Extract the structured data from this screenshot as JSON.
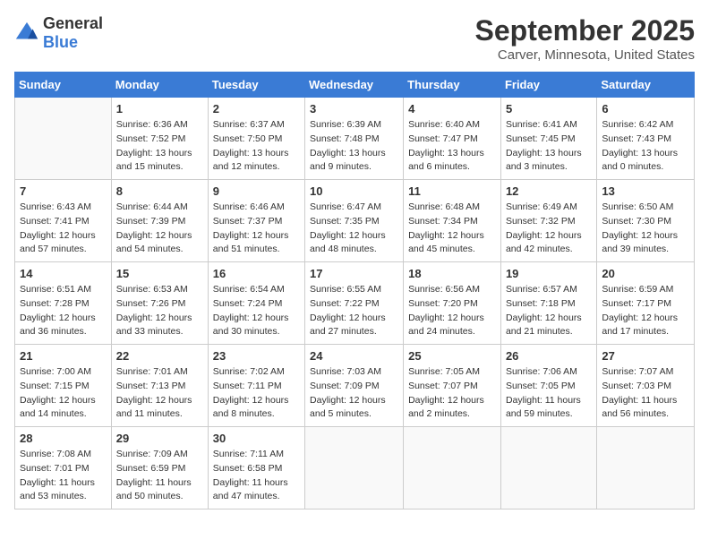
{
  "header": {
    "logo": {
      "general": "General",
      "blue": "Blue"
    },
    "title": "September 2025",
    "subtitle": "Carver, Minnesota, United States"
  },
  "calendar": {
    "weekdays": [
      "Sunday",
      "Monday",
      "Tuesday",
      "Wednesday",
      "Thursday",
      "Friday",
      "Saturday"
    ],
    "weeks": [
      [
        {
          "day": "",
          "sunrise": "",
          "sunset": "",
          "daylight": ""
        },
        {
          "day": "1",
          "sunrise": "Sunrise: 6:36 AM",
          "sunset": "Sunset: 7:52 PM",
          "daylight": "Daylight: 13 hours and 15 minutes."
        },
        {
          "day": "2",
          "sunrise": "Sunrise: 6:37 AM",
          "sunset": "Sunset: 7:50 PM",
          "daylight": "Daylight: 13 hours and 12 minutes."
        },
        {
          "day": "3",
          "sunrise": "Sunrise: 6:39 AM",
          "sunset": "Sunset: 7:48 PM",
          "daylight": "Daylight: 13 hours and 9 minutes."
        },
        {
          "day": "4",
          "sunrise": "Sunrise: 6:40 AM",
          "sunset": "Sunset: 7:47 PM",
          "daylight": "Daylight: 13 hours and 6 minutes."
        },
        {
          "day": "5",
          "sunrise": "Sunrise: 6:41 AM",
          "sunset": "Sunset: 7:45 PM",
          "daylight": "Daylight: 13 hours and 3 minutes."
        },
        {
          "day": "6",
          "sunrise": "Sunrise: 6:42 AM",
          "sunset": "Sunset: 7:43 PM",
          "daylight": "Daylight: 13 hours and 0 minutes."
        }
      ],
      [
        {
          "day": "7",
          "sunrise": "Sunrise: 6:43 AM",
          "sunset": "Sunset: 7:41 PM",
          "daylight": "Daylight: 12 hours and 57 minutes."
        },
        {
          "day": "8",
          "sunrise": "Sunrise: 6:44 AM",
          "sunset": "Sunset: 7:39 PM",
          "daylight": "Daylight: 12 hours and 54 minutes."
        },
        {
          "day": "9",
          "sunrise": "Sunrise: 6:46 AM",
          "sunset": "Sunset: 7:37 PM",
          "daylight": "Daylight: 12 hours and 51 minutes."
        },
        {
          "day": "10",
          "sunrise": "Sunrise: 6:47 AM",
          "sunset": "Sunset: 7:35 PM",
          "daylight": "Daylight: 12 hours and 48 minutes."
        },
        {
          "day": "11",
          "sunrise": "Sunrise: 6:48 AM",
          "sunset": "Sunset: 7:34 PM",
          "daylight": "Daylight: 12 hours and 45 minutes."
        },
        {
          "day": "12",
          "sunrise": "Sunrise: 6:49 AM",
          "sunset": "Sunset: 7:32 PM",
          "daylight": "Daylight: 12 hours and 42 minutes."
        },
        {
          "day": "13",
          "sunrise": "Sunrise: 6:50 AM",
          "sunset": "Sunset: 7:30 PM",
          "daylight": "Daylight: 12 hours and 39 minutes."
        }
      ],
      [
        {
          "day": "14",
          "sunrise": "Sunrise: 6:51 AM",
          "sunset": "Sunset: 7:28 PM",
          "daylight": "Daylight: 12 hours and 36 minutes."
        },
        {
          "day": "15",
          "sunrise": "Sunrise: 6:53 AM",
          "sunset": "Sunset: 7:26 PM",
          "daylight": "Daylight: 12 hours and 33 minutes."
        },
        {
          "day": "16",
          "sunrise": "Sunrise: 6:54 AM",
          "sunset": "Sunset: 7:24 PM",
          "daylight": "Daylight: 12 hours and 30 minutes."
        },
        {
          "day": "17",
          "sunrise": "Sunrise: 6:55 AM",
          "sunset": "Sunset: 7:22 PM",
          "daylight": "Daylight: 12 hours and 27 minutes."
        },
        {
          "day": "18",
          "sunrise": "Sunrise: 6:56 AM",
          "sunset": "Sunset: 7:20 PM",
          "daylight": "Daylight: 12 hours and 24 minutes."
        },
        {
          "day": "19",
          "sunrise": "Sunrise: 6:57 AM",
          "sunset": "Sunset: 7:18 PM",
          "daylight": "Daylight: 12 hours and 21 minutes."
        },
        {
          "day": "20",
          "sunrise": "Sunrise: 6:59 AM",
          "sunset": "Sunset: 7:17 PM",
          "daylight": "Daylight: 12 hours and 17 minutes."
        }
      ],
      [
        {
          "day": "21",
          "sunrise": "Sunrise: 7:00 AM",
          "sunset": "Sunset: 7:15 PM",
          "daylight": "Daylight: 12 hours and 14 minutes."
        },
        {
          "day": "22",
          "sunrise": "Sunrise: 7:01 AM",
          "sunset": "Sunset: 7:13 PM",
          "daylight": "Daylight: 12 hours and 11 minutes."
        },
        {
          "day": "23",
          "sunrise": "Sunrise: 7:02 AM",
          "sunset": "Sunset: 7:11 PM",
          "daylight": "Daylight: 12 hours and 8 minutes."
        },
        {
          "day": "24",
          "sunrise": "Sunrise: 7:03 AM",
          "sunset": "Sunset: 7:09 PM",
          "daylight": "Daylight: 12 hours and 5 minutes."
        },
        {
          "day": "25",
          "sunrise": "Sunrise: 7:05 AM",
          "sunset": "Sunset: 7:07 PM",
          "daylight": "Daylight: 12 hours and 2 minutes."
        },
        {
          "day": "26",
          "sunrise": "Sunrise: 7:06 AM",
          "sunset": "Sunset: 7:05 PM",
          "daylight": "Daylight: 11 hours and 59 minutes."
        },
        {
          "day": "27",
          "sunrise": "Sunrise: 7:07 AM",
          "sunset": "Sunset: 7:03 PM",
          "daylight": "Daylight: 11 hours and 56 minutes."
        }
      ],
      [
        {
          "day": "28",
          "sunrise": "Sunrise: 7:08 AM",
          "sunset": "Sunset: 7:01 PM",
          "daylight": "Daylight: 11 hours and 53 minutes."
        },
        {
          "day": "29",
          "sunrise": "Sunrise: 7:09 AM",
          "sunset": "Sunset: 6:59 PM",
          "daylight": "Daylight: 11 hours and 50 minutes."
        },
        {
          "day": "30",
          "sunrise": "Sunrise: 7:11 AM",
          "sunset": "Sunset: 6:58 PM",
          "daylight": "Daylight: 11 hours and 47 minutes."
        },
        {
          "day": "",
          "sunrise": "",
          "sunset": "",
          "daylight": ""
        },
        {
          "day": "",
          "sunrise": "",
          "sunset": "",
          "daylight": ""
        },
        {
          "day": "",
          "sunrise": "",
          "sunset": "",
          "daylight": ""
        },
        {
          "day": "",
          "sunrise": "",
          "sunset": "",
          "daylight": ""
        }
      ]
    ]
  }
}
